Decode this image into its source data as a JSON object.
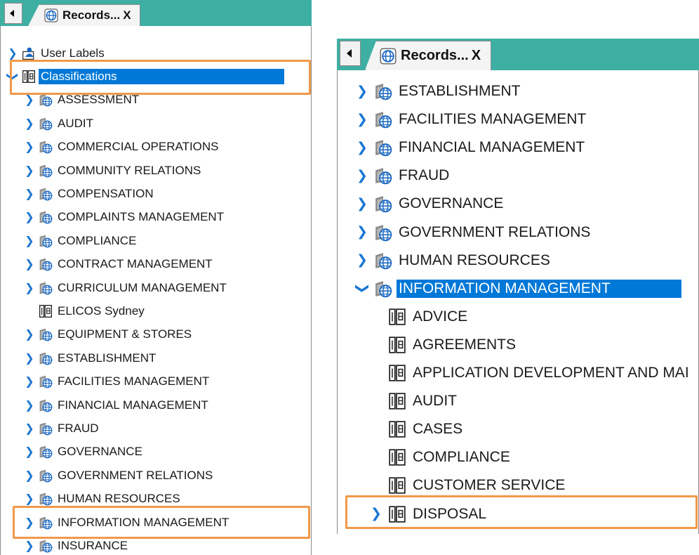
{
  "left_panel": {
    "back_button": "◄",
    "tab": {
      "title": "Records...",
      "close": "X"
    },
    "tree": [
      {
        "label": "User Labels",
        "icon": "user-labels-icon",
        "chevron": "collapsed"
      },
      {
        "label": "Classifications",
        "icon": "classification-book-icon",
        "chevron": "expanded",
        "selected": true
      },
      {
        "label": "ASSESSMENT",
        "icon": "classification-globe-icon",
        "chevron": "collapsed"
      },
      {
        "label": "AUDIT",
        "icon": "classification-globe-icon",
        "chevron": "collapsed"
      },
      {
        "label": "COMMERCIAL OPERATIONS",
        "icon": "classification-globe-icon",
        "chevron": "collapsed"
      },
      {
        "label": "COMMUNITY RELATIONS",
        "icon": "classification-globe-icon",
        "chevron": "collapsed"
      },
      {
        "label": "COMPENSATION",
        "icon": "classification-globe-icon",
        "chevron": "collapsed"
      },
      {
        "label": "COMPLAINTS MANAGEMENT",
        "icon": "classification-globe-icon",
        "chevron": "collapsed"
      },
      {
        "label": "COMPLIANCE",
        "icon": "classification-globe-icon",
        "chevron": "collapsed"
      },
      {
        "label": "CONTRACT MANAGEMENT",
        "icon": "classification-globe-icon",
        "chevron": "collapsed"
      },
      {
        "label": "CURRICULUM MANAGEMENT",
        "icon": "classification-globe-icon",
        "chevron": "collapsed"
      },
      {
        "label": "ELICOS Sydney",
        "icon": "classification-book-icon",
        "chevron": "none"
      },
      {
        "label": "EQUIPMENT & STORES",
        "icon": "classification-globe-icon",
        "chevron": "collapsed"
      },
      {
        "label": "ESTABLISHMENT",
        "icon": "classification-globe-icon",
        "chevron": "collapsed"
      },
      {
        "label": "FACILITIES MANAGEMENT",
        "icon": "classification-globe-icon",
        "chevron": "collapsed"
      },
      {
        "label": "FINANCIAL MANAGEMENT",
        "icon": "classification-globe-icon",
        "chevron": "collapsed"
      },
      {
        "label": "FRAUD",
        "icon": "classification-globe-icon",
        "chevron": "collapsed"
      },
      {
        "label": "GOVERNANCE",
        "icon": "classification-globe-icon",
        "chevron": "collapsed"
      },
      {
        "label": "GOVERNMENT RELATIONS",
        "icon": "classification-globe-icon",
        "chevron": "collapsed"
      },
      {
        "label": "HUMAN RESOURCES",
        "icon": "classification-globe-icon",
        "chevron": "collapsed"
      },
      {
        "label": "INFORMATION MANAGEMENT",
        "icon": "classification-globe-icon",
        "chevron": "collapsed"
      },
      {
        "label": "INSURANCE",
        "icon": "classification-globe-icon",
        "chevron": "collapsed"
      }
    ]
  },
  "right_panel": {
    "back_button": "◄",
    "tab": {
      "title": "Records...",
      "close": "X"
    },
    "tree": [
      {
        "label": "ESTABLISHMENT",
        "icon": "classification-globe-icon",
        "chevron": "collapsed"
      },
      {
        "label": "FACILITIES MANAGEMENT",
        "icon": "classification-globe-icon",
        "chevron": "collapsed"
      },
      {
        "label": "FINANCIAL MANAGEMENT",
        "icon": "classification-globe-icon",
        "chevron": "collapsed"
      },
      {
        "label": "FRAUD",
        "icon": "classification-globe-icon",
        "chevron": "collapsed"
      },
      {
        "label": "GOVERNANCE",
        "icon": "classification-globe-icon",
        "chevron": "collapsed"
      },
      {
        "label": "GOVERNMENT RELATIONS",
        "icon": "classification-globe-icon",
        "chevron": "collapsed"
      },
      {
        "label": "HUMAN RESOURCES",
        "icon": "classification-globe-icon",
        "chevron": "collapsed"
      },
      {
        "label": "INFORMATION MANAGEMENT",
        "icon": "classification-globe-icon",
        "chevron": "expanded",
        "selected": true
      },
      {
        "label": "ADVICE",
        "icon": "classification-book-icon",
        "chevron": "none"
      },
      {
        "label": "AGREEMENTS",
        "icon": "classification-book-icon",
        "chevron": "none"
      },
      {
        "label": "APPLICATION DEVELOPMENT AND MAI",
        "icon": "classification-book-icon",
        "chevron": "none"
      },
      {
        "label": "AUDIT",
        "icon": "classification-book-icon",
        "chevron": "none"
      },
      {
        "label": "CASES",
        "icon": "classification-book-icon",
        "chevron": "none"
      },
      {
        "label": "COMPLIANCE",
        "icon": "classification-book-icon",
        "chevron": "none"
      },
      {
        "label": "CUSTOMER SERVICE",
        "icon": "classification-book-icon",
        "chevron": "none"
      },
      {
        "label": "DISPOSAL",
        "icon": "classification-book-icon",
        "chevron": "collapsed"
      }
    ]
  },
  "colors": {
    "tabbar": "#3eafa3",
    "selection": "#0078d7",
    "chevron": "#1976d2",
    "highlight": "#f0994a"
  }
}
